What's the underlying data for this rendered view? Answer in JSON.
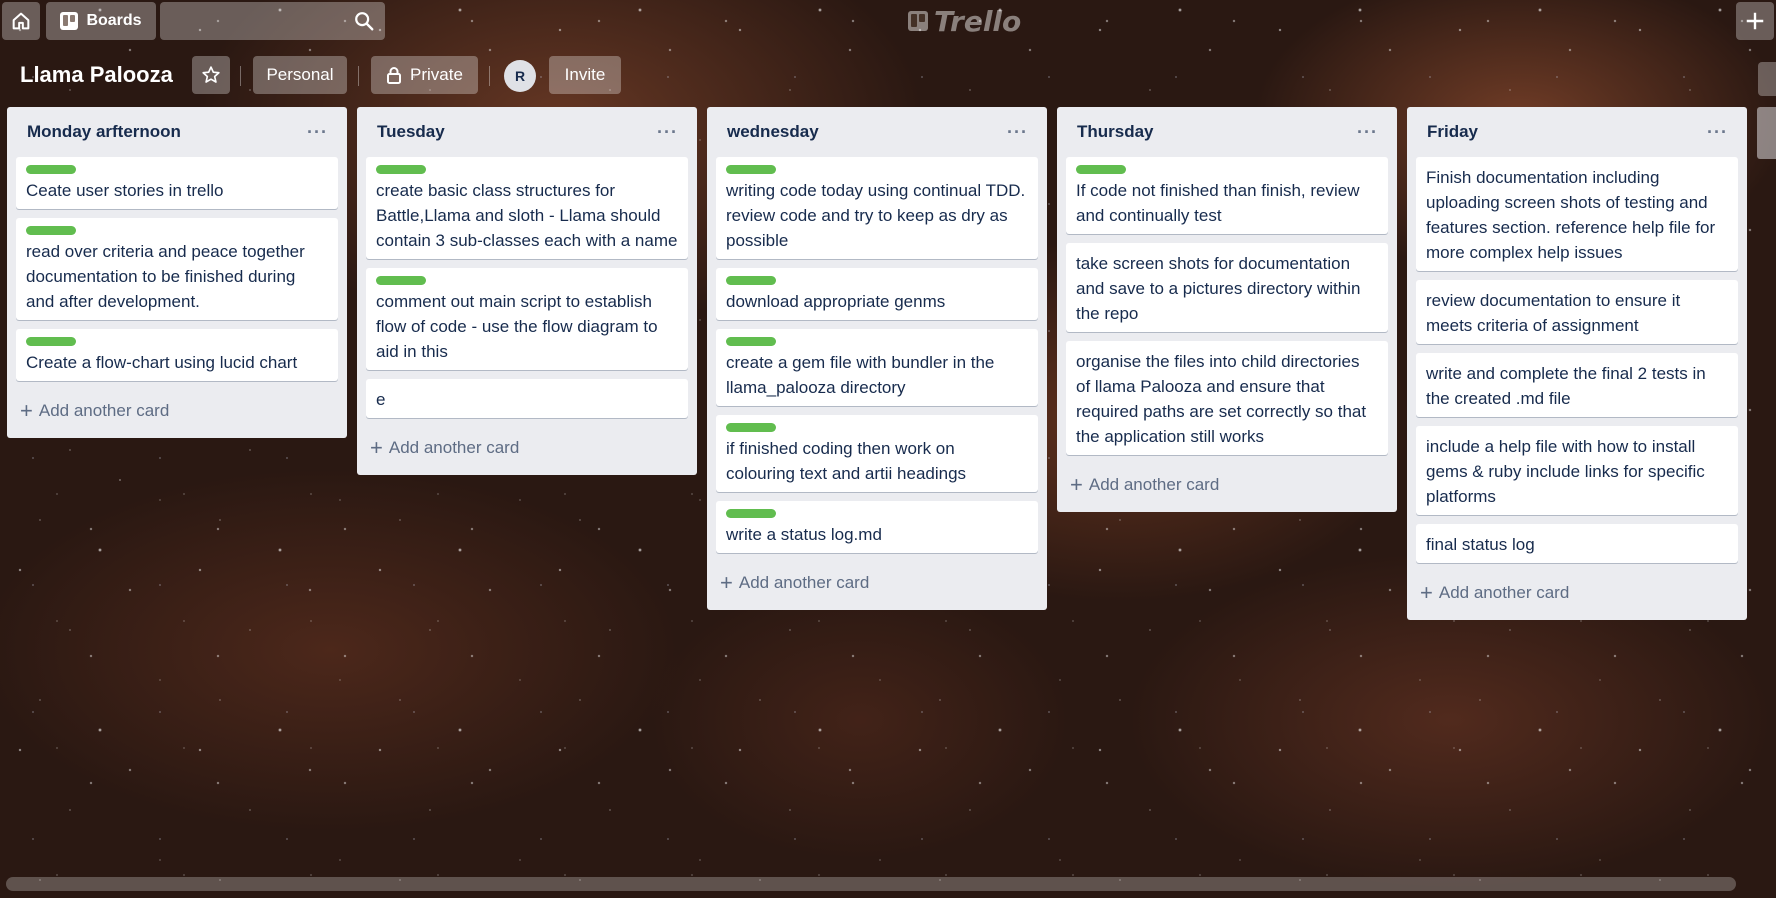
{
  "header": {
    "boards_label": "Boards",
    "logo_text": "Trello"
  },
  "board": {
    "title": "Llama Palooza",
    "personal_label": "Personal",
    "private_label": "Private",
    "avatar_initial": "R",
    "invite_label": "Invite"
  },
  "label_color": "#61bd4f",
  "add_card_label": "Add another card",
  "lists": [
    {
      "title": "Monday arfternoon",
      "cards": [
        {
          "text": "Ceate user stories in trello",
          "label": true
        },
        {
          "text": "read over criteria and peace together documentation to be finished during and after development.",
          "label": true
        },
        {
          "text": "Create a flow-chart using lucid chart",
          "label": true
        }
      ]
    },
    {
      "title": "Tuesday",
      "cards": [
        {
          "text": "create basic class structures for Battle,Llama and sloth - Llama should contain 3 sub-classes each with a name",
          "label": true
        },
        {
          "text": "comment out main script to establish flow of code - use the flow diagram to aid in this",
          "label": true
        },
        {
          "text": "e",
          "label": false
        }
      ]
    },
    {
      "title": "wednesday",
      "cards": [
        {
          "text": "writing code today using continual TDD. review code and try to keep as dry as possible",
          "label": true
        },
        {
          "text": "download appropriate genms",
          "label": true
        },
        {
          "text": "create a gem file with bundler in the llama_palooza directory",
          "label": true
        },
        {
          "text": "if finished coding then work on colouring text and artii headings",
          "label": true
        },
        {
          "text": "write a status log.md",
          "label": true
        }
      ]
    },
    {
      "title": "Thursday",
      "cards": [
        {
          "text": "If code not finished than finish, review and continually test",
          "label": true
        },
        {
          "text": "take screen shots for documentation and save to a pictures directory within the repo",
          "label": false
        },
        {
          "text": "organise the files into child directories of llama Palooza and ensure that required paths are set correctly so that the application still works",
          "label": false
        }
      ]
    },
    {
      "title": "Friday",
      "cards": [
        {
          "text": "Finish documentation including uploading screen shots of testing and features section. reference help file for more complex help issues",
          "label": false
        },
        {
          "text": "review documentation to ensure it meets criteria of assignment",
          "label": false
        },
        {
          "text": "write and complete the final 2 tests in the created .md file",
          "label": false
        },
        {
          "text": "include a help file with how to install gems & ruby include links for specific platforms",
          "label": false
        },
        {
          "text": "final status log",
          "label": false
        }
      ]
    }
  ]
}
